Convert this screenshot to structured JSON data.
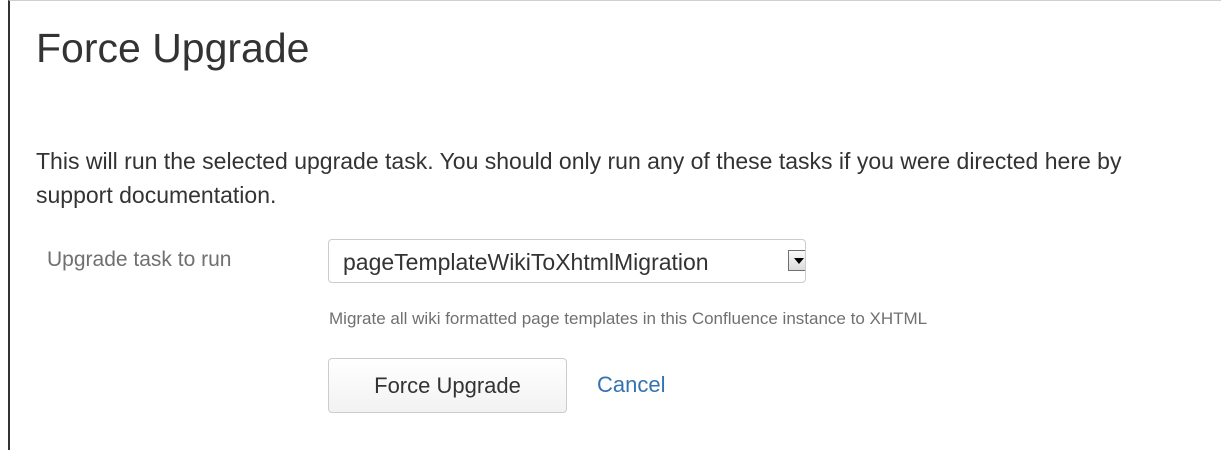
{
  "page": {
    "title": "Force Upgrade",
    "description": "This will run the selected upgrade task. You should only run any of these tasks if you were directed here by support documentation."
  },
  "form": {
    "task_label": "Upgrade task to run",
    "task_select": {
      "selected_value": "pageTemplateWikiToXhtmlMigration",
      "arrow_icon": "dropdown-arrow-icon"
    },
    "help_text": "Migrate all wiki formatted page templates in this Confluence instance to XHTML",
    "submit_label": "Force Upgrade",
    "cancel_label": "Cancel"
  },
  "colors": {
    "text": "#333333",
    "muted_text": "#707070",
    "link": "#3572b0",
    "border": "#cccccc"
  }
}
